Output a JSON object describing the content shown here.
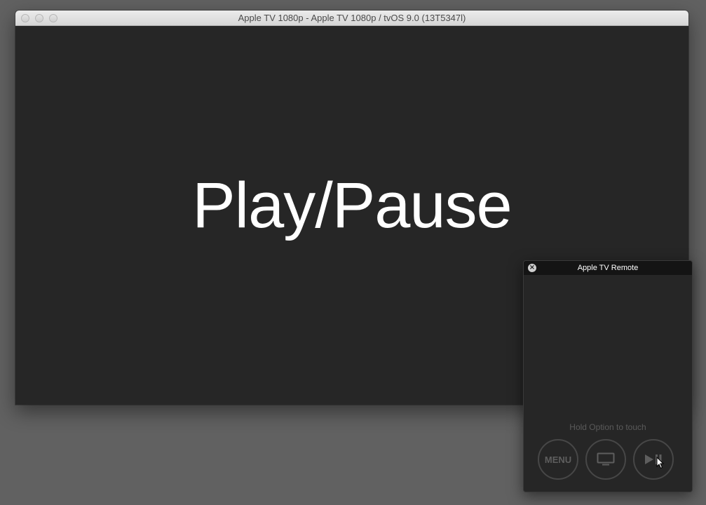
{
  "simulator_window": {
    "title": "Apple TV 1080p - Apple TV 1080p / tvOS 9.0 (13T5347l)",
    "screen_text": "Play/Pause"
  },
  "remote": {
    "title": "Apple TV Remote",
    "hint": "Hold Option to touch",
    "buttons": {
      "menu_label": "MENU",
      "home_icon": "tv-screen-icon",
      "play_pause_icon": "play-pause-icon"
    }
  },
  "colors": {
    "desktop": "#616161",
    "screen_bg": "#262626",
    "screen_text": "#ffffff",
    "remote_title_bg": "#141414",
    "button_outline": "#474747"
  }
}
